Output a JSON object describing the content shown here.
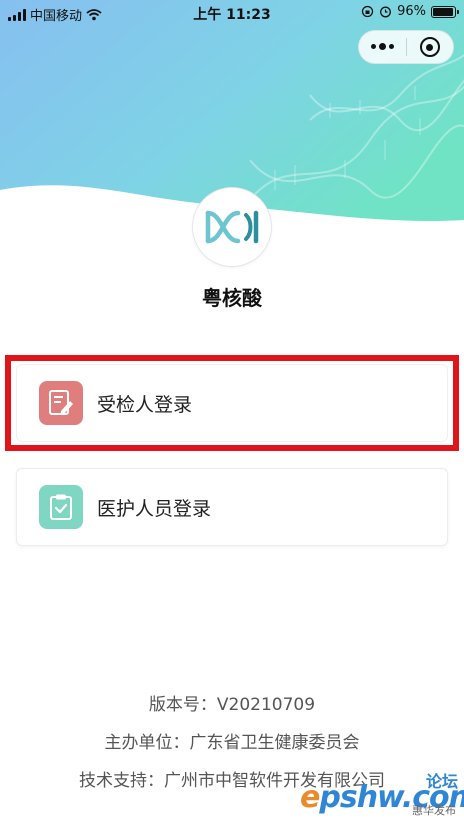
{
  "status_bar": {
    "carrier": "中国移动",
    "time": "上午 11:23",
    "battery_percent": "96%",
    "battery_level": 0.96
  },
  "capsule": {
    "menu_icon": "more-dots-icon",
    "close_icon": "target-circle-icon"
  },
  "app": {
    "name": "粤核酸",
    "logo_icon": "dna-logo-icon"
  },
  "login_options": [
    {
      "label": "受检人登录",
      "icon": "edit-document-icon",
      "color": "#e07e7e"
    },
    {
      "label": "医护人员登录",
      "icon": "clipboard-check-icon",
      "color": "#7fd6c2"
    }
  ],
  "footer": {
    "version": "版本号：V20210709",
    "organizer": "主办单位：广东省卫生健康委员会",
    "tech_support": "技术支持：广州市中智软件开发有限公司"
  },
  "watermark": {
    "main_prefix": "e",
    "main_rest": "pshw.com",
    "top": "论坛",
    "bottom": "惠华发布"
  },
  "colors": {
    "highlight_border": "#e0141b",
    "hero_gradient_start": "#7ec4ef",
    "hero_gradient_end": "#6fe0c6"
  }
}
